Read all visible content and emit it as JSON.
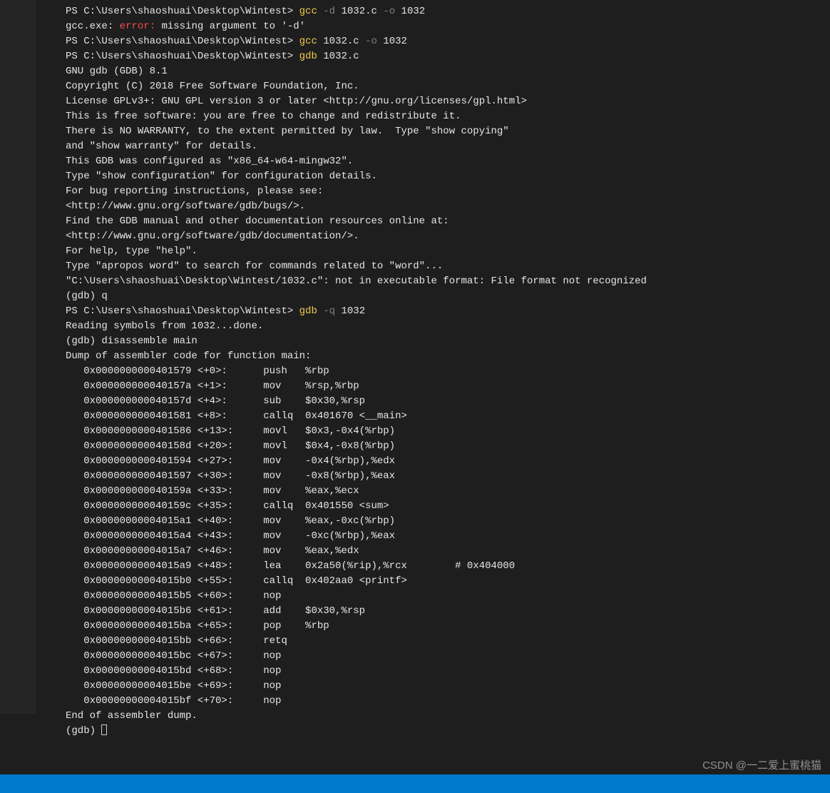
{
  "prompt": "PS C:\\Users\\shaoshuai\\Desktop\\Wintest> ",
  "cmd1": {
    "bin": "gcc",
    "flag": "-d",
    "rest": "1032.c",
    "oflag": "-o",
    "out": "1032"
  },
  "err_prefix": "gcc.exe: ",
  "err_word": "error:",
  "err_msg": " missing argument to '-d'",
  "cmd2": {
    "bin": "gcc",
    "rest": "1032.c",
    "oflag": "-o",
    "out": "1032"
  },
  "cmd3": {
    "bin": "gdb",
    "rest": "1032.c"
  },
  "gdb_banner": [
    "GNU gdb (GDB) 8.1",
    "Copyright (C) 2018 Free Software Foundation, Inc.",
    "License GPLv3+: GNU GPL version 3 or later <http://gnu.org/licenses/gpl.html>",
    "This is free software: you are free to change and redistribute it.",
    "There is NO WARRANTY, to the extent permitted by law.  Type \"show copying\"",
    "and \"show warranty\" for details.",
    "This GDB was configured as \"x86_64-w64-mingw32\".",
    "Type \"show configuration\" for configuration details.",
    "For bug reporting instructions, please see:",
    "<http://www.gnu.org/software/gdb/bugs/>.",
    "Find the GDB manual and other documentation resources online at:",
    "<http://www.gnu.org/software/gdb/documentation/>.",
    "For help, type \"help\".",
    "Type \"apropos word\" to search for commands related to \"word\"...",
    "\"C:\\Users\\shaoshuai\\Desktop\\Wintest/1032.c\": not in executable format: File format not recognized"
  ],
  "gdb_q": "(gdb) q",
  "cmd4": {
    "bin": "gdb",
    "flag": "-q",
    "rest": "1032"
  },
  "reading": "Reading symbols from 1032...done.",
  "disas_cmd": "(gdb) disassemble main",
  "dump_header": "Dump of assembler code for function main:",
  "asm": [
    {
      "addr": "0x0000000000401579",
      "off": "<+0>:",
      "mn": "push",
      "args": "%rbp"
    },
    {
      "addr": "0x000000000040157a",
      "off": "<+1>:",
      "mn": "mov",
      "args": "%rsp,%rbp"
    },
    {
      "addr": "0x000000000040157d",
      "off": "<+4>:",
      "mn": "sub",
      "args": "$0x30,%rsp"
    },
    {
      "addr": "0x0000000000401581",
      "off": "<+8>:",
      "mn": "callq",
      "args": "0x401670 <__main>"
    },
    {
      "addr": "0x0000000000401586",
      "off": "<+13>:",
      "mn": "movl",
      "args": "$0x3,-0x4(%rbp)"
    },
    {
      "addr": "0x000000000040158d",
      "off": "<+20>:",
      "mn": "movl",
      "args": "$0x4,-0x8(%rbp)"
    },
    {
      "addr": "0x0000000000401594",
      "off": "<+27>:",
      "mn": "mov",
      "args": "-0x4(%rbp),%edx"
    },
    {
      "addr": "0x0000000000401597",
      "off": "<+30>:",
      "mn": "mov",
      "args": "-0x8(%rbp),%eax"
    },
    {
      "addr": "0x000000000040159a",
      "off": "<+33>:",
      "mn": "mov",
      "args": "%eax,%ecx"
    },
    {
      "addr": "0x000000000040159c",
      "off": "<+35>:",
      "mn": "callq",
      "args": "0x401550 <sum>"
    },
    {
      "addr": "0x00000000004015a1",
      "off": "<+40>:",
      "mn": "mov",
      "args": "%eax,-0xc(%rbp)"
    },
    {
      "addr": "0x00000000004015a4",
      "off": "<+43>:",
      "mn": "mov",
      "args": "-0xc(%rbp),%eax"
    },
    {
      "addr": "0x00000000004015a7",
      "off": "<+46>:",
      "mn": "mov",
      "args": "%eax,%edx"
    },
    {
      "addr": "0x00000000004015a9",
      "off": "<+48>:",
      "mn": "lea",
      "args": "0x2a50(%rip),%rcx        # 0x404000"
    },
    {
      "addr": "0x00000000004015b0",
      "off": "<+55>:",
      "mn": "callq",
      "args": "0x402aa0 <printf>"
    },
    {
      "addr": "0x00000000004015b5",
      "off": "<+60>:",
      "mn": "nop",
      "args": ""
    },
    {
      "addr": "0x00000000004015b6",
      "off": "<+61>:",
      "mn": "add",
      "args": "$0x30,%rsp"
    },
    {
      "addr": "0x00000000004015ba",
      "off": "<+65>:",
      "mn": "pop",
      "args": "%rbp"
    },
    {
      "addr": "0x00000000004015bb",
      "off": "<+66>:",
      "mn": "retq",
      "args": ""
    },
    {
      "addr": "0x00000000004015bc",
      "off": "<+67>:",
      "mn": "nop",
      "args": ""
    },
    {
      "addr": "0x00000000004015bd",
      "off": "<+68>:",
      "mn": "nop",
      "args": ""
    },
    {
      "addr": "0x00000000004015be",
      "off": "<+69>:",
      "mn": "nop",
      "args": ""
    },
    {
      "addr": "0x00000000004015bf",
      "off": "<+70>:",
      "mn": "nop",
      "args": ""
    }
  ],
  "dump_end": "End of assembler dump.",
  "gdb_prompt": "(gdb) ",
  "watermark": "CSDN @一二爱上蜜桃猫"
}
